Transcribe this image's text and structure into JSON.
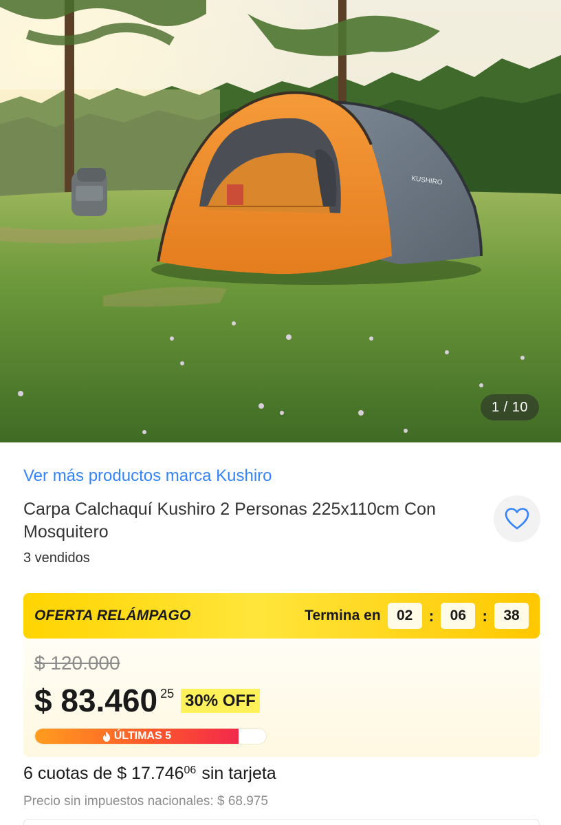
{
  "gallery": {
    "counter": "1 / 10",
    "tent_print": "KUSHIRO"
  },
  "product": {
    "brand_link": "Ver más productos marca Kushiro",
    "title": "Carpa Calchaquí Kushiro 2 Personas 225x110cm Con Mosquitero",
    "sold": "3 vendidos",
    "favorite_icon": "heart-icon"
  },
  "deal": {
    "label": "OFERTA RELÁMPAGO",
    "ends_label": "Termina en",
    "hours": "02",
    "minutes": "06",
    "seconds": "38",
    "separator": ":"
  },
  "price": {
    "original": "$ 120.000",
    "current": "$ 83.460",
    "cents": "25",
    "discount": "30% OFF"
  },
  "stock": {
    "label": "ÚLTIMAS 5",
    "icon": "fire-icon",
    "fill_fraction": 0.88
  },
  "installments": {
    "prefix": "6 cuotas de $ 17.746",
    "cents": "06",
    "suffix": "sin tarjeta"
  },
  "tax_note": "Precio sin impuestos nacionales: $ 68.975",
  "colors": {
    "link": "#3483fa",
    "deal_yellow": "#ffd400",
    "badge_yellow": "#fff159",
    "stock_red": "#f2294b"
  }
}
